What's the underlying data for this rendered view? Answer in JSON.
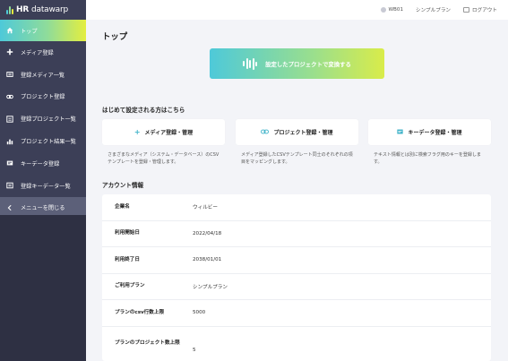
{
  "brand": {
    "name_bold": "HR",
    "name_light": "datawarp"
  },
  "header": {
    "user": "WB01",
    "plan": "シンプルプラン",
    "logout": "ログアウト"
  },
  "sidebar": {
    "items": [
      {
        "label": "トップ",
        "icon": "home-icon"
      },
      {
        "label": "メディア登録",
        "icon": "plus-icon"
      },
      {
        "label": "登録メディア一覧",
        "icon": "list-icon"
      },
      {
        "label": "プロジェクト登録",
        "icon": "link-icon"
      },
      {
        "label": "登録プロジェクト一覧",
        "icon": "list-icon"
      },
      {
        "label": "プロジェクト結果一覧",
        "icon": "chart-icon"
      },
      {
        "label": "キーデータ登録",
        "icon": "key-card-icon"
      },
      {
        "label": "登録キーデータ一覧",
        "icon": "list-icon"
      }
    ],
    "collapse": "メニューを閉じる"
  },
  "main": {
    "title": "トップ",
    "convert_button": "設定したプロジェクトで変換する",
    "intro_title": "はじめて設定される方はこちら",
    "cards": [
      {
        "label": "メディア登録・管理",
        "icon": "plus-icon",
        "desc": "さまざまなメディア（システム・データベース）のCSVテンプレートを登録・管理します。"
      },
      {
        "label": "プロジェクト登録・管理",
        "icon": "link-icon",
        "desc": "メディア登録したCSVテンプレート同士のそれぞれの項目をマッピングします。"
      },
      {
        "label": "キーデータ登録・管理",
        "icon": "key-card-icon",
        "desc": "テキスト情報とは別に検索フラグ用のキーを登録します。"
      }
    ],
    "account_title": "アカウント情報",
    "account_rows": [
      {
        "label": "企業名",
        "value": "ウィルビー"
      },
      {
        "label": "利用開始日",
        "value": "2022/04/18"
      },
      {
        "label": "利用終了日",
        "value": "2038/01/01"
      },
      {
        "label": "ご利用プラン",
        "value": "シンプルプラン"
      },
      {
        "label": "プランのcsv行数上限",
        "value": "5000"
      },
      {
        "label": "プランのプロジェクト数上限",
        "value": "5"
      }
    ]
  },
  "colors": {
    "sidebar": "#3c3f57",
    "accent_cyan": "#4ec9d9",
    "accent_yellow": "#e4ee3f"
  }
}
